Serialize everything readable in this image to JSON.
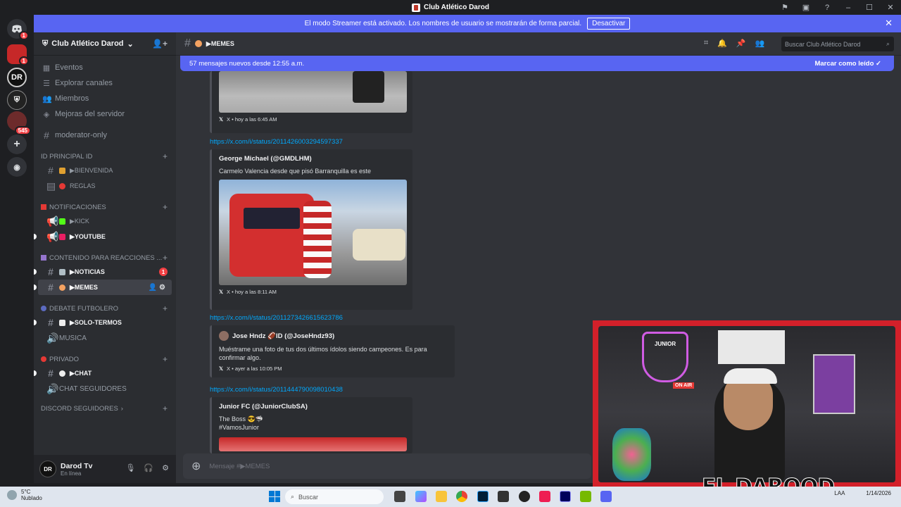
{
  "window": {
    "title": "Club Atlético Darod"
  },
  "streamer_bar": {
    "text": "El modo Streamer está activado. Los nombres de usuario se mostrarán de forma parcial.",
    "button": "Desactivar"
  },
  "rail": {
    "badges": [
      "1",
      "1",
      "545"
    ]
  },
  "server": {
    "name": "Club Atlético Darod"
  },
  "nav": [
    {
      "label": "Eventos"
    },
    {
      "label": "Explorar canales"
    },
    {
      "label": "Miembros"
    },
    {
      "label": "Mejoras del servidor"
    }
  ],
  "moderator_channel": "moderator-only",
  "categories": {
    "principal": "ID PRINCIPAL ID",
    "notificaciones": "NOTIFICACIONES",
    "contenido": "CONTENIDO PARA REACCIONES ...",
    "debate": "DEBATE FUTBOLERO",
    "privado": "PRIVADO",
    "discord_seguidores": "DISCORD SEGUIDORES"
  },
  "channels": {
    "bienvenida": "▶BIENVENIDA",
    "reglas": "REGLAS",
    "kick": "▶KICK",
    "youtube": "▶YOUTUBE",
    "noticias": "▶NOTICIAS",
    "noticias_count": "1",
    "memes": "▶MEMES",
    "solo_termos": "▶SOLO-TERMOS",
    "musica": "MUSICA",
    "chat": "▶CHAT",
    "chat_seguidores": "CHAT SEGUIDORES"
  },
  "user": {
    "name": "Darod Tv",
    "status": "En línea"
  },
  "chat": {
    "channel": "▶MEMES",
    "search_placeholder": "Buscar Club Atlético Darod",
    "new_messages": "57 mensajes nuevos desde 12:55 a.m.",
    "mark_read": "Marcar como leído",
    "composer_placeholder": "Mensaje #▶MEMES"
  },
  "messages": [
    {
      "footer": "X • hoy a las 6:45 AM"
    },
    {
      "link": "https://x.com/i/status/2011426003294597337",
      "author": "George Michael (@GMDLHM)",
      "text": "Carmelo Valencia desde que pisó Barranquilla es este",
      "footer": "X • hoy a las 8:11 AM"
    },
    {
      "link": "https://x.com/i/status/2011273426615623786",
      "author": "Jose Hndz 🏈ID (@JoseHndz93)",
      "text": "Muéstrame una foto de tus dos últimos ídolos siendo campeones. Es para confirmar algo.",
      "footer": "X • ayer a las 10:05 PM"
    },
    {
      "link": "https://x.com/i/status/2011444790098010438",
      "author": "Junior FC (@JuniorClubSA)",
      "text": "The Boss 😎🦈",
      "text2": "#VamosJunior"
    }
  ],
  "overlay": {
    "brand": "EL DAROOD",
    "on_air": "ON AIR",
    "sign": "JUNIOR"
  },
  "taskbar": {
    "temp": "5°C",
    "weather": "Nublado",
    "search": "Buscar",
    "lang": "LAA",
    "date": "1/14/2026"
  },
  "colors": {
    "accent": "#5865f2",
    "link": "#00a8fc",
    "danger": "#f23f43",
    "bg": "#313338",
    "sidebar": "#2b2d31"
  }
}
